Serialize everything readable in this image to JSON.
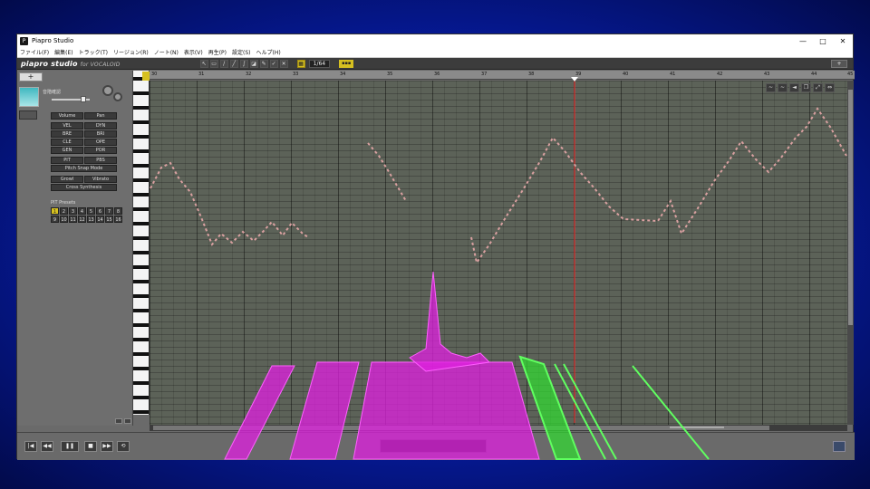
{
  "window": {
    "title": "Piapro Studio",
    "controls": [
      "—",
      "□",
      "✕"
    ]
  },
  "menu": [
    "ファイル(F)",
    "編集(E)",
    "トラック(T)",
    "リージョン(R)",
    "ノート(N)",
    "表示(V)",
    "再生(P)",
    "設定(S)",
    "ヘルプ(H)"
  ],
  "toolbar": {
    "logo": "piapro studio",
    "logo_suffix": "for VOCALOID",
    "quantize": "1/64",
    "settings_button": "+"
  },
  "track": {
    "name": "音階確認",
    "add_label": "+"
  },
  "params": {
    "volume": "Volume",
    "pan": "Pan",
    "vel": "VEL",
    "dyn": "DYN",
    "bre": "BRE",
    "bri": "BRI",
    "cle": "CLE",
    "ope": "OPE",
    "gen": "GEN",
    "por": "POR",
    "pit": "PIT",
    "pbs": "PBS",
    "pitch_snap": "Pitch Snap Mode",
    "growl": "Growl",
    "vibrato": "Vibrato",
    "cross_synthesis": "Cross Synthesis",
    "pit_presets": "PIT Presets"
  },
  "preset_numbers": [
    "1",
    "2",
    "3",
    "4",
    "5",
    "6",
    "7",
    "8",
    "9",
    "10",
    "11",
    "12",
    "13",
    "14",
    "15",
    "16"
  ],
  "ruler_labels": [
    "30",
    "31",
    "32",
    "33",
    "34",
    "35",
    "36",
    "37",
    "38",
    "39",
    "40",
    "41",
    "42",
    "43",
    "44",
    "45"
  ],
  "transport": {
    "rewind_start": "|◀",
    "rewind": "◀◀",
    "pause": "❚❚",
    "stop": "■",
    "forward": "▶▶",
    "loop": "⟲"
  },
  "colors": {
    "background": "#0a2fd8",
    "accent": "#d6c020",
    "note_fill": "#d9a0a0",
    "playhead": "#ff3030",
    "visualizer_magenta": "#e020e0",
    "visualizer_green": "#30e030"
  }
}
